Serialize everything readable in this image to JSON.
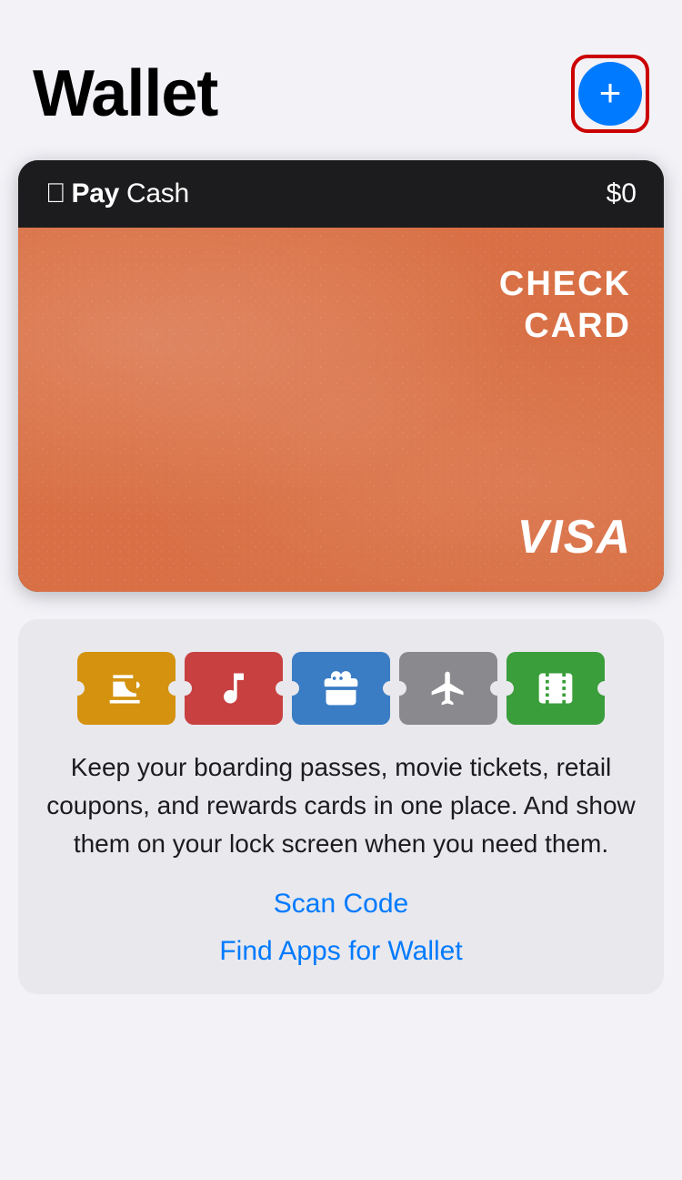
{
  "header": {
    "title": "Wallet",
    "add_button_label": "+"
  },
  "apple_pay": {
    "logo_text": "Pay Cash",
    "logo_prefix": "",
    "balance": "$0"
  },
  "visa_card": {
    "card_type_line1": "CHECK",
    "card_type_line2": "CARD",
    "network": "VISA"
  },
  "passes_section": {
    "description": "Keep your boarding passes, movie tickets, retail coupons, and rewards cards in one place. And show them on your lock screen when you need them.",
    "scan_code_label": "Scan Code",
    "find_apps_label": "Find Apps for Wallet"
  },
  "pass_icons": [
    {
      "name": "coffee",
      "type": "coffee-icon"
    },
    {
      "name": "music",
      "type": "music-icon"
    },
    {
      "name": "gift",
      "type": "gift-icon"
    },
    {
      "name": "flight",
      "type": "flight-icon"
    },
    {
      "name": "movie",
      "type": "movie-icon"
    }
  ],
  "colors": {
    "accent": "#007aff",
    "add_button": "#007aff",
    "card_bg": "#d97045",
    "header_bg": "#1c1c1e"
  }
}
